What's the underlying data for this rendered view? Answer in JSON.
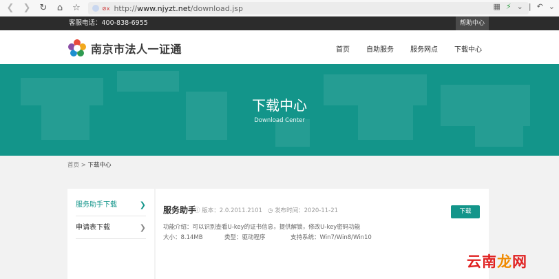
{
  "browser": {
    "url_scheme": "http://",
    "url_host": "www.njyzt.net",
    "url_path": "/download.jsp",
    "perm_label": "⊘x"
  },
  "topbar": {
    "hotline": "客服电话：400-838-6955",
    "help_label": "帮助中心"
  },
  "header": {
    "site_name": "南京市法人一证通",
    "nav": [
      "首页",
      "自助服务",
      "服务网点",
      "下载中心"
    ]
  },
  "banner": {
    "title": "下载中心",
    "subtitle": "Download Center",
    "color": "#13958a"
  },
  "breadcrumb": {
    "home": "首页",
    "sep": ">",
    "current": "下载中心"
  },
  "sidebar": {
    "items": [
      {
        "label": "服务助手下载",
        "active": true
      },
      {
        "label": "申请表下载",
        "active": false
      }
    ]
  },
  "product": {
    "name": "服务助手",
    "version_label": "版本：2.0.2011.2101",
    "date_label": "发布时间：2020-11-21",
    "download_label": "下载",
    "description": "功能介绍：可以识别查看U-key的证书信息，提供解锁，修改U-key密码功能",
    "size": "大小：8.14MB",
    "type": "类型：驱动程序",
    "system": "支持系统：Win7/Win8/Win10"
  },
  "watermark": {
    "part1": "云南",
    "part2": "龙",
    "part3": "网"
  },
  "colors": {
    "accent": "#13958a",
    "topbar": "#2c2c2c"
  }
}
